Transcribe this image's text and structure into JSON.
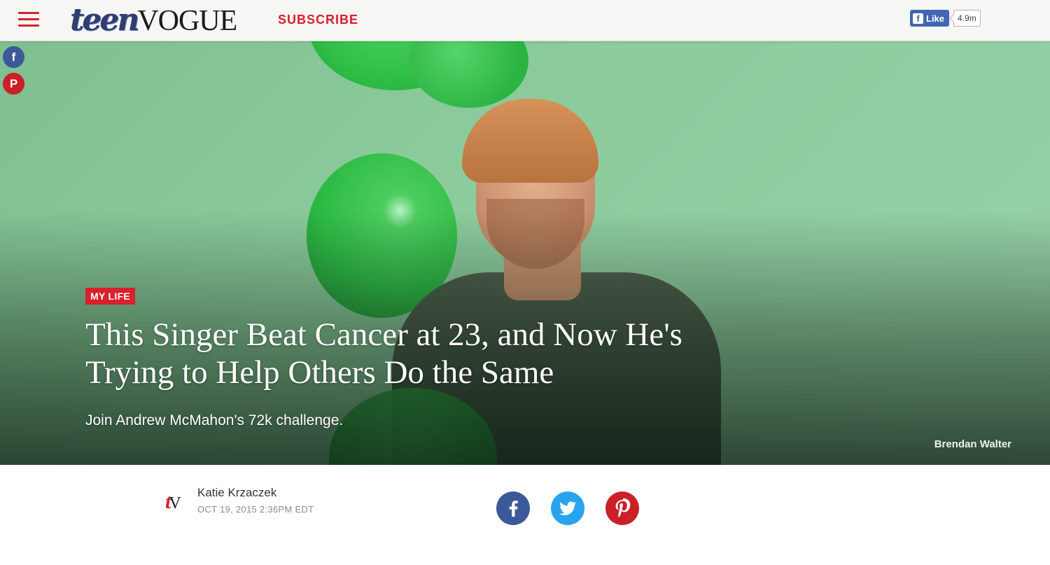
{
  "header": {
    "logo_teen": "teen",
    "logo_vogue": "VOGUE",
    "subscribe_label": "SUBSCRIBE",
    "fb_like_label": "Like",
    "fb_like_count": "4.9m"
  },
  "hero": {
    "category": "MY LIFE",
    "headline": "This Singer Beat Cancer at 23, and Now He's Trying to Help Others Do the Same",
    "dek": "Join Andrew McMahon's 72k challenge.",
    "photo_credit": "Brendan Walter"
  },
  "byline": {
    "logo_t": "t",
    "logo_v": "V",
    "author": "Katie Krzaczek",
    "date": "OCT 19, 2015 2:36PM EDT"
  },
  "share": {
    "items": [
      {
        "icon": "facebook-icon",
        "glyph": "f"
      },
      {
        "icon": "twitter-icon",
        "glyph": "t"
      },
      {
        "icon": "pinterest-icon",
        "glyph": "p"
      }
    ]
  },
  "colors": {
    "brand_red": "#d9202b",
    "facebook": "#3b5998",
    "twitter": "#2aa3ef",
    "pinterest": "#cb2027"
  }
}
